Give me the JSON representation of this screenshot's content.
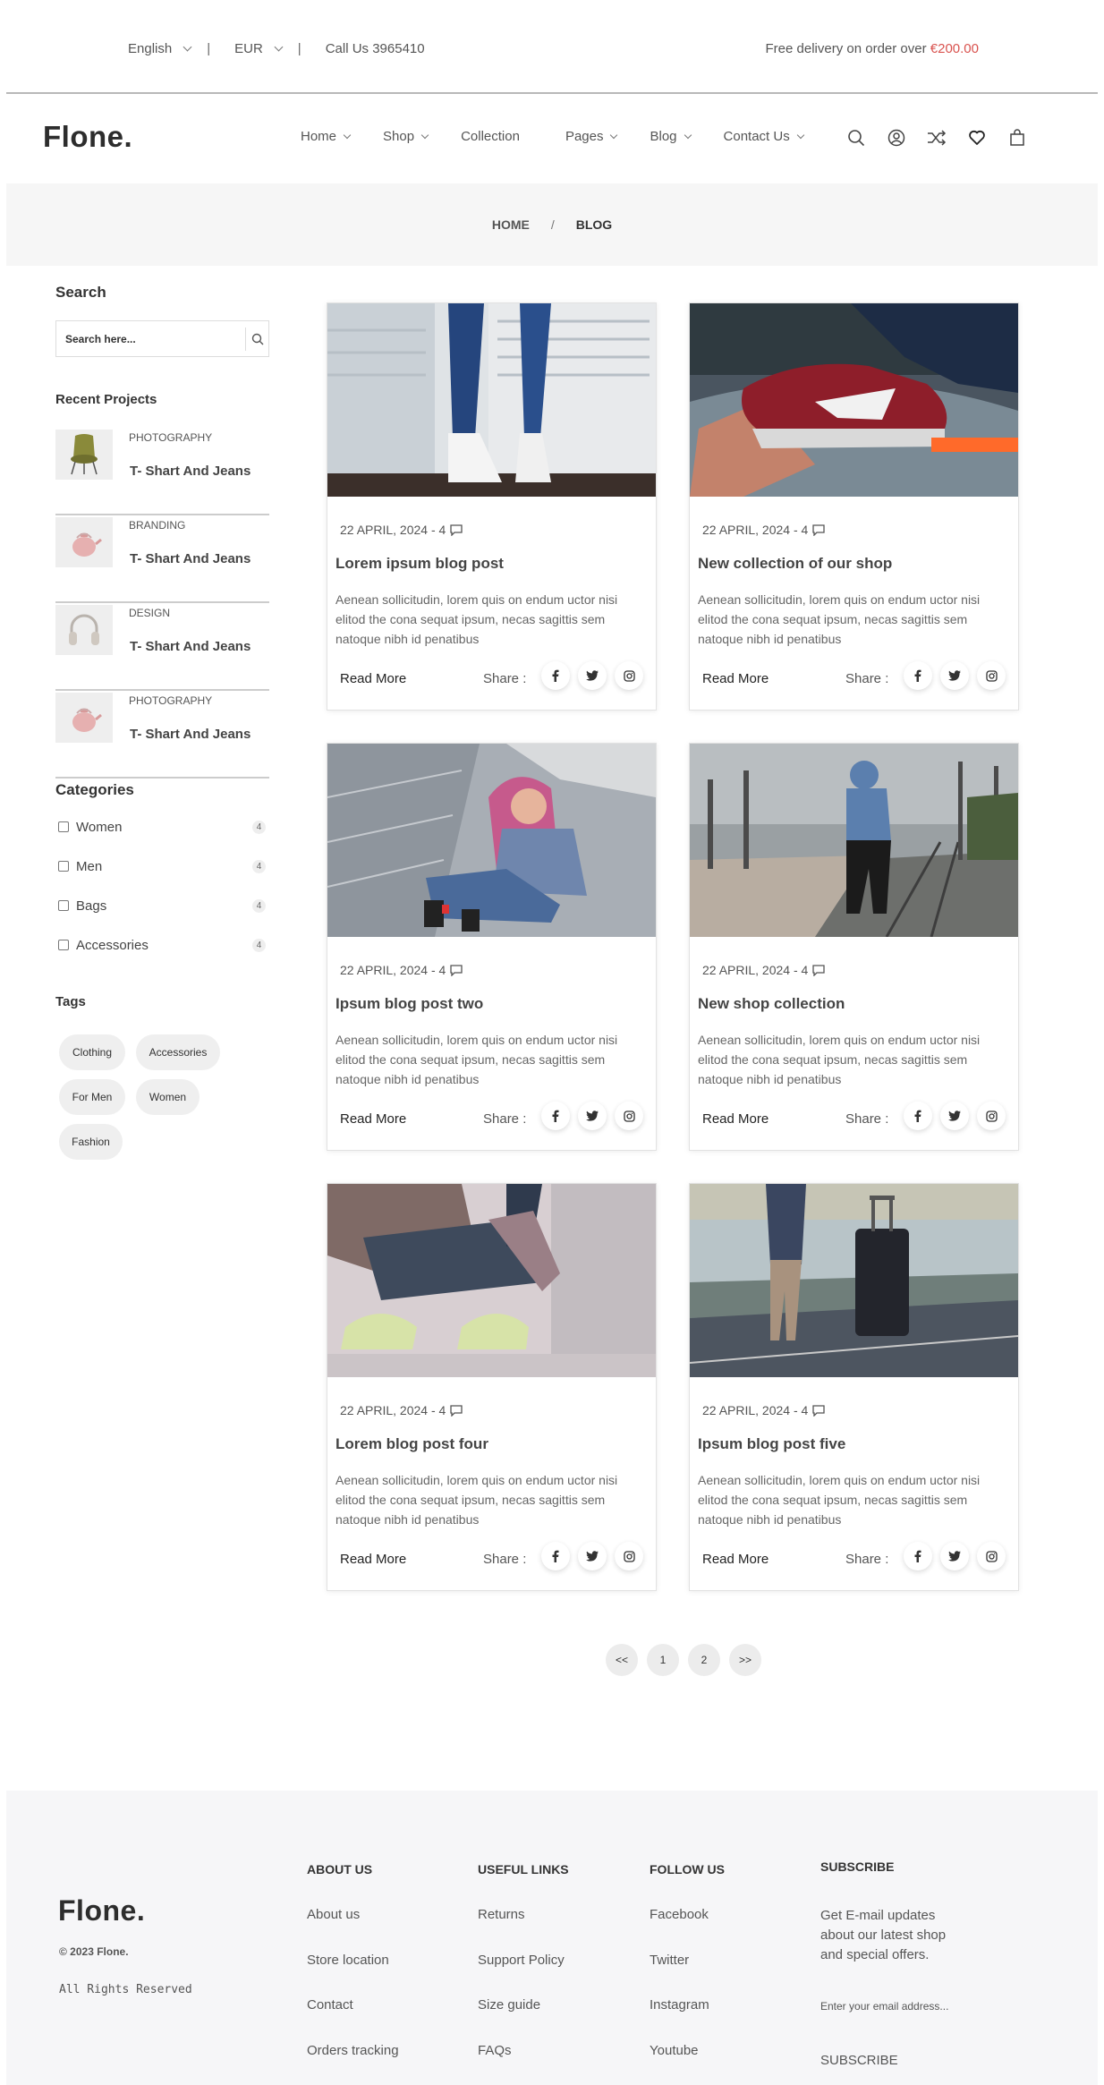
{
  "topbar": {
    "language": "English",
    "currency": "EUR",
    "phone": "Call Us 3965410",
    "delivery_text": "Free delivery on order over ",
    "delivery_amount": "€200.00"
  },
  "header": {
    "logo": "Flone.",
    "nav": [
      {
        "label": "Home",
        "dropdown": true
      },
      {
        "label": "Shop",
        "dropdown": true
      },
      {
        "label": "Collection",
        "dropdown": false
      },
      {
        "label": "Pages",
        "dropdown": true
      },
      {
        "label": "Blog",
        "dropdown": true
      },
      {
        "label": "Contact Us",
        "dropdown": true
      }
    ],
    "icons": [
      "search-icon",
      "account-icon",
      "compare-icon",
      "wishlist-icon",
      "cart-icon"
    ]
  },
  "breadcrumb": {
    "home": "HOME",
    "separator": "/",
    "current": "BLOG"
  },
  "sidebar": {
    "search_title": "Search",
    "search_placeholder": "Search here...",
    "recent_title": "Recent Projects",
    "recent": [
      {
        "category": "PHOTOGRAPHY",
        "title": "T- Shart And Jeans",
        "thumb": "chair"
      },
      {
        "category": "BRANDING",
        "title": "T- Shart And Jeans",
        "thumb": "kettle"
      },
      {
        "category": "DESIGN",
        "title": "T- Shart And Jeans",
        "thumb": "headphones"
      },
      {
        "category": "PHOTOGRAPHY",
        "title": "T- Shart And Jeans",
        "thumb": "kettle"
      }
    ],
    "categories_title": "Categories",
    "categories": [
      {
        "label": "Women",
        "count": "4"
      },
      {
        "label": "Men",
        "count": "4"
      },
      {
        "label": "Bags",
        "count": "4"
      },
      {
        "label": "Accessories",
        "count": "4"
      }
    ],
    "tags_title": "Tags",
    "tags": [
      "Clothing",
      "Accessories",
      "For Men",
      "Women",
      "Fashion"
    ]
  },
  "posts": [
    {
      "date": "22 APRIL, 2024 - 4",
      "title": "Lorem ipsum blog post",
      "desc": "Aenean sollicitudin, lorem quis on endum uctor nisi elitod the cona sequat ipsum, necas sagittis sem natoque nibh id penatibus",
      "read_more": "Read More",
      "share": "Share :",
      "image": "jeans-sneakers"
    },
    {
      "date": "22 APRIL, 2024 - 4",
      "title": "New collection of our shop",
      "desc": "Aenean sollicitudin, lorem quis on endum uctor nisi elitod the cona sequat ipsum, necas sagittis sem natoque nibh id penatibus",
      "read_more": "Read More",
      "share": "Share :",
      "image": "red-sneaker"
    },
    {
      "date": "22 APRIL, 2024 - 4",
      "title": "Ipsum blog post two",
      "desc": "Aenean sollicitudin, lorem quis on endum uctor nisi elitod the cona sequat ipsum, necas sagittis sem natoque nibh id penatibus",
      "read_more": "Read More",
      "share": "Share :",
      "image": "pink-hair-woman"
    },
    {
      "date": "22 APRIL, 2024 - 4",
      "title": "New shop collection",
      "desc": "Aenean sollicitudin, lorem quis on endum uctor nisi elitod the cona sequat ipsum, necas sagittis sem natoque nibh id penatibus",
      "read_more": "Read More",
      "share": "Share :",
      "image": "railway-man"
    },
    {
      "date": "22 APRIL, 2024 - 4",
      "title": "Lorem blog post four",
      "desc": "Aenean sollicitudin, lorem quis on endum uctor nisi elitod the cona sequat ipsum, necas sagittis sem natoque nibh id penatibus",
      "read_more": "Read More",
      "share": "Share :",
      "image": "crouching-sneakers"
    },
    {
      "date": "22 APRIL, 2024 - 4",
      "title": "Ipsum blog post five",
      "desc": "Aenean sollicitudin, lorem quis on endum uctor nisi elitod the cona sequat ipsum, necas sagittis sem natoque nibh id penatibus",
      "read_more": "Read More",
      "share": "Share :",
      "image": "road-suitcase"
    }
  ],
  "pagination": [
    "<<",
    "1",
    "2",
    ">>"
  ],
  "footer": {
    "logo": "Flone.",
    "copyright": "© 2023 Flone.",
    "rights": "All Rights Reserved",
    "columns": [
      {
        "heading": "ABOUT US",
        "links": [
          "About us",
          "Store location",
          "Contact",
          "Orders tracking"
        ]
      },
      {
        "heading": "USEFUL LINKS",
        "links": [
          "Returns",
          "Support Policy",
          "Size guide",
          "FAQs"
        ]
      },
      {
        "heading": "FOLLOW US",
        "links": [
          "Facebook",
          "Twitter",
          "Instagram",
          "Youtube"
        ]
      }
    ],
    "subscribe_heading": "SUBSCRIBE",
    "subscribe_text": "Get E-mail updates about our latest shop and special offers.",
    "subscribe_placeholder": "Enter your email address...",
    "subscribe_button": "SUBSCRIBE"
  },
  "colors": {
    "accent": "#d9534f",
    "breadcrumb_bg": "#f6f6f6",
    "footer_bg": "#f6f6f8"
  }
}
